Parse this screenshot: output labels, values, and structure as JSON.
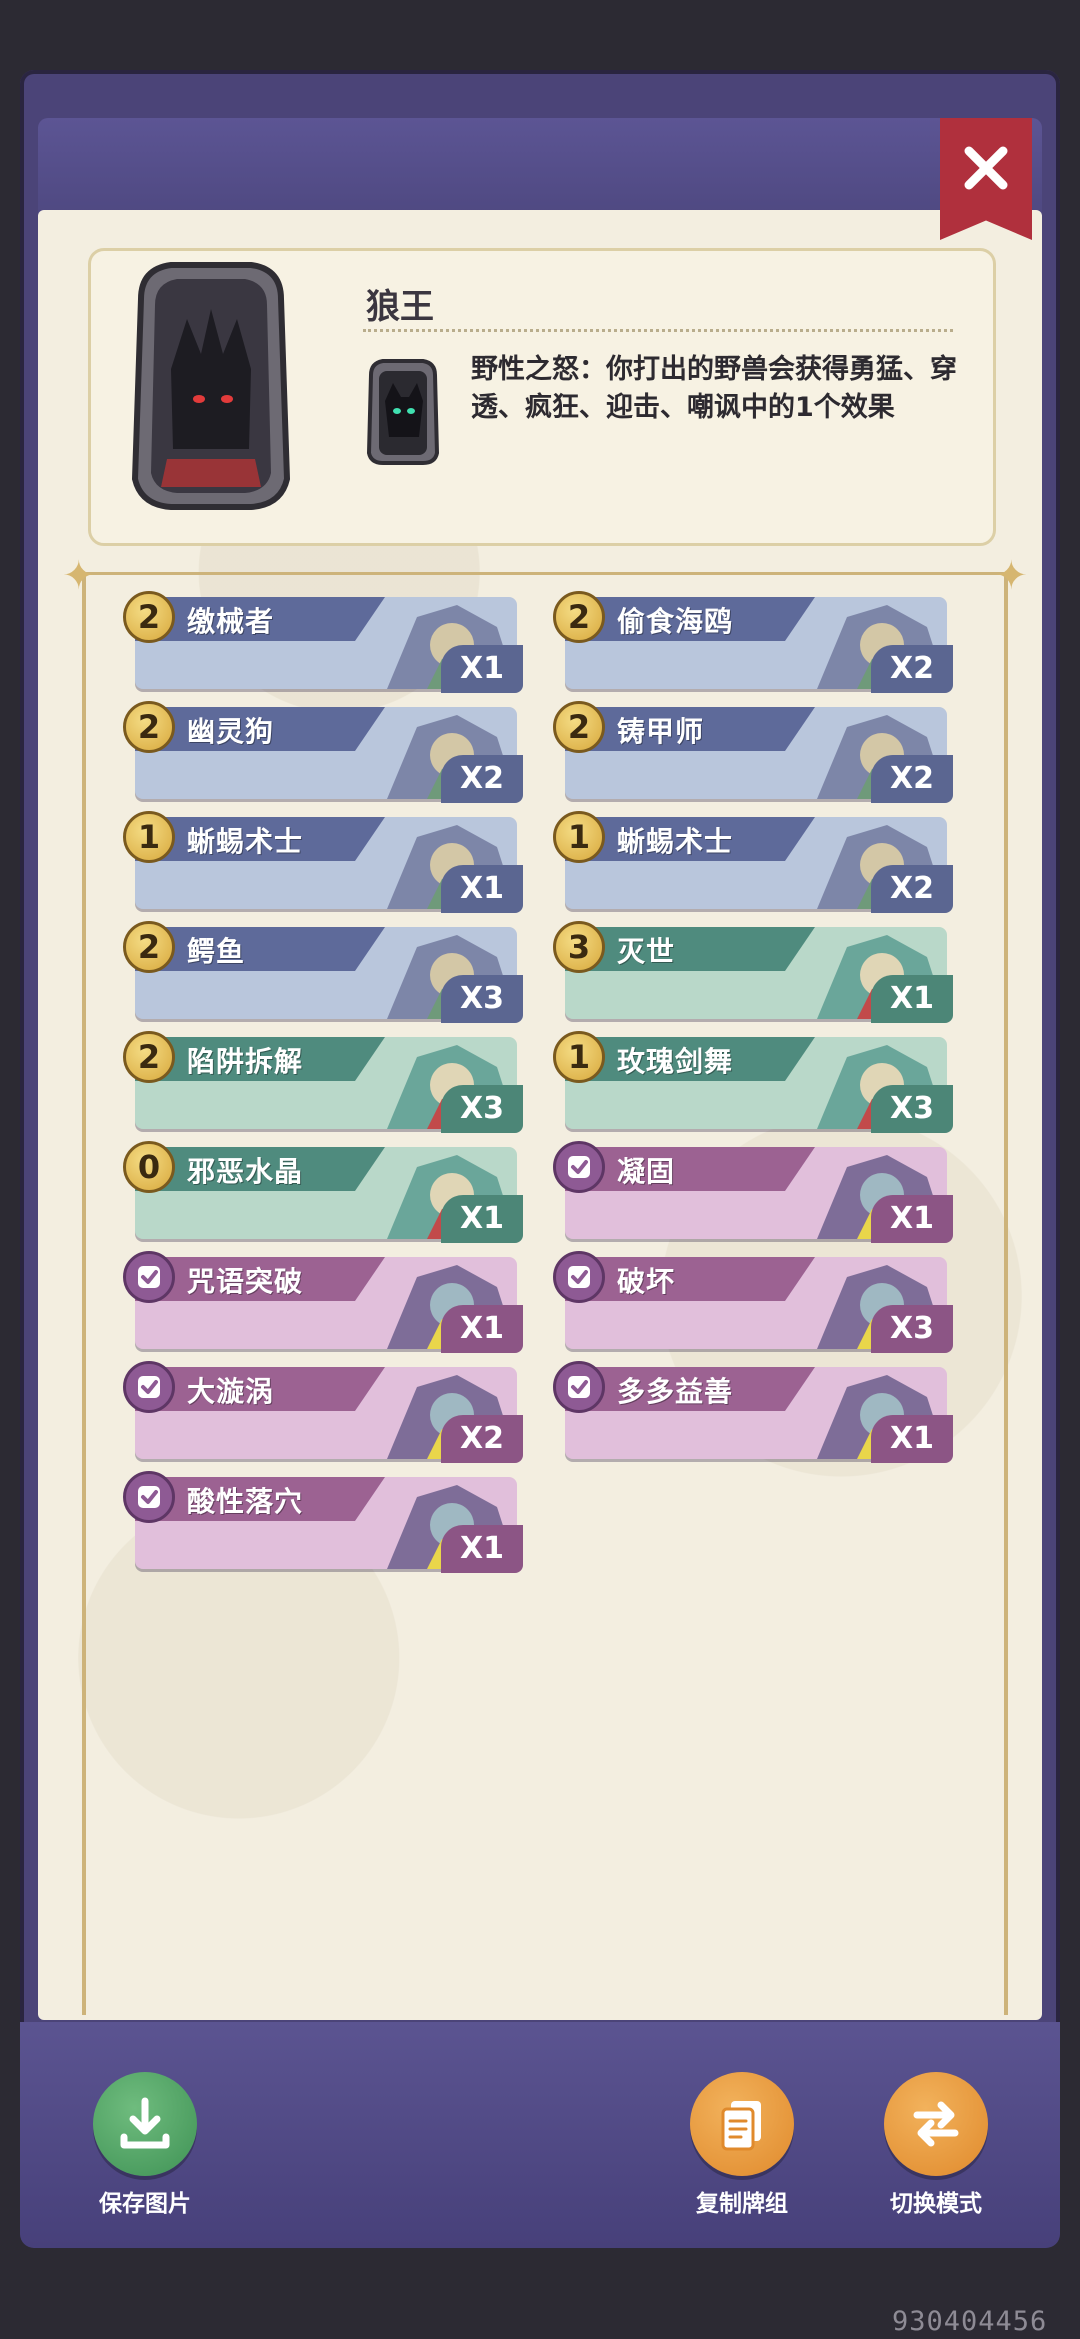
{
  "hero": {
    "name": "狼王",
    "skill": "野性之怒：你打出的野兽会获得勇猛、穿透、疯狂、迎击、嘲讽中的1个效果"
  },
  "cards": [
    {
      "name": "缴械者",
      "cost": "2",
      "qty": "X1",
      "theme": "blue"
    },
    {
      "name": "偷食海鸥",
      "cost": "2",
      "qty": "X2",
      "theme": "blue"
    },
    {
      "name": "幽灵狗",
      "cost": "2",
      "qty": "X2",
      "theme": "blue"
    },
    {
      "name": "铸甲师",
      "cost": "2",
      "qty": "X2",
      "theme": "blue"
    },
    {
      "name": "蜥蜴术士",
      "cost": "1",
      "qty": "X1",
      "theme": "blue"
    },
    {
      "name": "蜥蜴术士",
      "cost": "1",
      "qty": "X2",
      "theme": "blue"
    },
    {
      "name": "鳄鱼",
      "cost": "2",
      "qty": "X3",
      "theme": "blue"
    },
    {
      "name": "灭世",
      "cost": "3",
      "qty": "X1",
      "theme": "teal"
    },
    {
      "name": "陷阱拆解",
      "cost": "2",
      "qty": "X3",
      "theme": "teal"
    },
    {
      "name": "玫瑰剑舞",
      "cost": "1",
      "qty": "X3",
      "theme": "teal"
    },
    {
      "name": "邪恶水晶",
      "cost": "0",
      "qty": "X1",
      "theme": "teal"
    },
    {
      "name": "凝固",
      "cost": "",
      "qty": "X1",
      "theme": "purple"
    },
    {
      "name": "咒语突破",
      "cost": "",
      "qty": "X1",
      "theme": "purple"
    },
    {
      "name": "破坏",
      "cost": "",
      "qty": "X3",
      "theme": "purple"
    },
    {
      "name": "大漩涡",
      "cost": "",
      "qty": "X2",
      "theme": "purple"
    },
    {
      "name": "多多益善",
      "cost": "",
      "qty": "X1",
      "theme": "purple"
    },
    {
      "name": "酸性落穴",
      "cost": "",
      "qty": "X1",
      "theme": "purple"
    }
  ],
  "actions": {
    "save": "保存图片",
    "copy": "复制牌组",
    "switch": "切换模式"
  },
  "watermark": "930404456",
  "colors": {
    "frame": "#4b4478",
    "panel": "#f3eee0",
    "close": "#b0303d",
    "cost_gold": "#e4b84c"
  }
}
